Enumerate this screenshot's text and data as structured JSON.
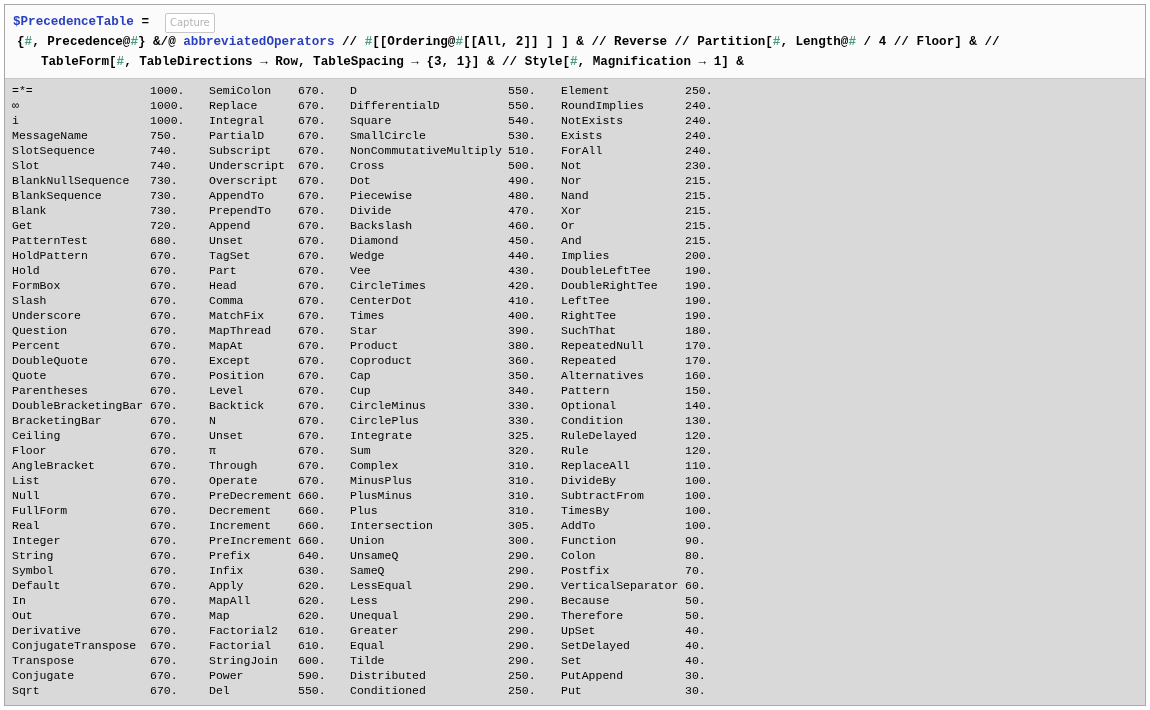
{
  "input": {
    "lines": [
      [
        {
          "kind": "global",
          "text": "$PrecedenceTable"
        },
        {
          "kind": "plain",
          "text": " ="
        }
      ],
      [
        {
          "kind": "plain",
          "text": "{"
        },
        {
          "kind": "slot",
          "text": "#"
        },
        {
          "kind": "plain",
          "text": ", Precedence@"
        },
        {
          "kind": "slot",
          "text": "#"
        },
        {
          "kind": "plain",
          "text": "} &/@ "
        },
        {
          "kind": "global",
          "text": "abbreviatedOperators"
        },
        {
          "kind": "plain",
          "text": " // "
        },
        {
          "kind": "slot",
          "text": "#"
        },
        {
          "kind": "plain",
          "text": "[[Ordering@"
        },
        {
          "kind": "slot",
          "text": "#"
        },
        {
          "kind": "plain",
          "text": "[[All, 2]] ] ] & // Reverse // Partition["
        },
        {
          "kind": "slot",
          "text": "#"
        },
        {
          "kind": "plain",
          "text": ", Length@"
        },
        {
          "kind": "slot",
          "text": "#"
        },
        {
          "kind": "plain",
          "text": " / 4 // Floor] & //"
        }
      ],
      [
        {
          "kind": "plain",
          "text": "TableForm["
        },
        {
          "kind": "slot",
          "text": "#"
        },
        {
          "kind": "plain",
          "text": ", TableDirections → Row, TableSpacing → {3, 1}] & // Style["
        },
        {
          "kind": "slot",
          "text": "#"
        },
        {
          "kind": "plain",
          "text": ", Magnification → 1] &"
        }
      ]
    ],
    "tooltip": "Capture"
  },
  "table": {
    "rows": [
      [
        "=*=",
        "1000.",
        "SemiColon",
        "670.",
        "D",
        "550.",
        "Element",
        "250."
      ],
      [
        "∞",
        "1000.",
        "Replace",
        "670.",
        "DifferentialD",
        "550.",
        "RoundImplies",
        "240."
      ],
      [
        "i",
        "1000.",
        "Integral",
        "670.",
        "Square",
        "540.",
        "NotExists",
        "240."
      ],
      [
        "MessageName",
        "750.",
        "PartialD",
        "670.",
        "SmallCircle",
        "530.",
        "Exists",
        "240."
      ],
      [
        "SlotSequence",
        "740.",
        "Subscript",
        "670.",
        "NonCommutativeMultiply",
        "510.",
        "ForAll",
        "240."
      ],
      [
        "Slot",
        "740.",
        "Underscript",
        "670.",
        "Cross",
        "500.",
        "Not",
        "230."
      ],
      [
        "BlankNullSequence",
        "730.",
        "Overscript",
        "670.",
        "Dot",
        "490.",
        "Nor",
        "215."
      ],
      [
        "BlankSequence",
        "730.",
        "AppendTo",
        "670.",
        "Piecewise",
        "480.",
        "Nand",
        "215."
      ],
      [
        "Blank",
        "730.",
        "PrependTo",
        "670.",
        "Divide",
        "470.",
        "Xor",
        "215."
      ],
      [
        "Get",
        "720.",
        "Append",
        "670.",
        "Backslash",
        "460.",
        "Or",
        "215."
      ],
      [
        "PatternTest",
        "680.",
        "Unset",
        "670.",
        "Diamond",
        "450.",
        "And",
        "215."
      ],
      [
        "HoldPattern",
        "670.",
        "TagSet",
        "670.",
        "Wedge",
        "440.",
        "Implies",
        "200."
      ],
      [
        "Hold",
        "670.",
        "Part",
        "670.",
        "Vee",
        "430.",
        "DoubleLeftTee",
        "190."
      ],
      [
        "FormBox",
        "670.",
        "Head",
        "670.",
        "CircleTimes",
        "420.",
        "DoubleRightTee",
        "190."
      ],
      [
        "Slash",
        "670.",
        "Comma",
        "670.",
        "CenterDot",
        "410.",
        "LeftTee",
        "190."
      ],
      [
        "Underscore",
        "670.",
        "MatchFix",
        "670.",
        "Times",
        "400.",
        "RightTee",
        "190."
      ],
      [
        "Question",
        "670.",
        "MapThread",
        "670.",
        "Star",
        "390.",
        "SuchThat",
        "180."
      ],
      [
        "Percent",
        "670.",
        "MapAt",
        "670.",
        "Product",
        "380.",
        "RepeatedNull",
        "170."
      ],
      [
        "DoubleQuote",
        "670.",
        "Except",
        "670.",
        "Coproduct",
        "360.",
        "Repeated",
        "170."
      ],
      [
        "Quote",
        "670.",
        "Position",
        "670.",
        "Cap",
        "350.",
        "Alternatives",
        "160."
      ],
      [
        "Parentheses",
        "670.",
        "Level",
        "670.",
        "Cup",
        "340.",
        "Pattern",
        "150."
      ],
      [
        "DoubleBracketingBar",
        "670.",
        "Backtick",
        "670.",
        "CircleMinus",
        "330.",
        "Optional",
        "140."
      ],
      [
        "BracketingBar",
        "670.",
        "N",
        "670.",
        "CirclePlus",
        "330.",
        "Condition",
        "130."
      ],
      [
        "Ceiling",
        "670.",
        "Unset",
        "670.",
        "Integrate",
        "325.",
        "RuleDelayed",
        "120."
      ],
      [
        "Floor",
        "670.",
        "π",
        "670.",
        "Sum",
        "320.",
        "Rule",
        "120."
      ],
      [
        "AngleBracket",
        "670.",
        "Through",
        "670.",
        "Complex",
        "310.",
        "ReplaceAll",
        "110."
      ],
      [
        "List",
        "670.",
        "Operate",
        "670.",
        "MinusPlus",
        "310.",
        "DivideBy",
        "100."
      ],
      [
        "Null",
        "670.",
        "PreDecrement",
        "660.",
        "PlusMinus",
        "310.",
        "SubtractFrom",
        "100."
      ],
      [
        "FullForm",
        "670.",
        "Decrement",
        "660.",
        "Plus",
        "310.",
        "TimesBy",
        "100."
      ],
      [
        "Real",
        "670.",
        "Increment",
        "660.",
        "Intersection",
        "305.",
        "AddTo",
        "100."
      ],
      [
        "Integer",
        "670.",
        "PreIncrement",
        "660.",
        "Union",
        "300.",
        "Function",
        "90."
      ],
      [
        "String",
        "670.",
        "Prefix",
        "640.",
        "UnsameQ",
        "290.",
        "Colon",
        "80."
      ],
      [
        "Symbol",
        "670.",
        "Infix",
        "630.",
        "SameQ",
        "290.",
        "Postfix",
        "70."
      ],
      [
        "Default",
        "670.",
        "Apply",
        "620.",
        "LessEqual",
        "290.",
        "VerticalSeparator",
        "60."
      ],
      [
        "In",
        "670.",
        "MapAll",
        "620.",
        "Less",
        "290.",
        "Because",
        "50."
      ],
      [
        "Out",
        "670.",
        "Map",
        "620.",
        "Unequal",
        "290.",
        "Therefore",
        "50."
      ],
      [
        "Derivative",
        "670.",
        "Factorial2",
        "610.",
        "Greater",
        "290.",
        "UpSet",
        "40."
      ],
      [
        "ConjugateTranspose",
        "670.",
        "Factorial",
        "610.",
        "Equal",
        "290.",
        "SetDelayed",
        "40."
      ],
      [
        "Transpose",
        "670.",
        "StringJoin",
        "600.",
        "Tilde",
        "290.",
        "Set",
        "40."
      ],
      [
        "Conjugate",
        "670.",
        "Power",
        "590.",
        "Distributed",
        "250.",
        "PutAppend",
        "30."
      ],
      [
        "Sqrt",
        "670.",
        "Del",
        "550.",
        "Conditioned",
        "250.",
        "Put",
        "30."
      ]
    ]
  }
}
